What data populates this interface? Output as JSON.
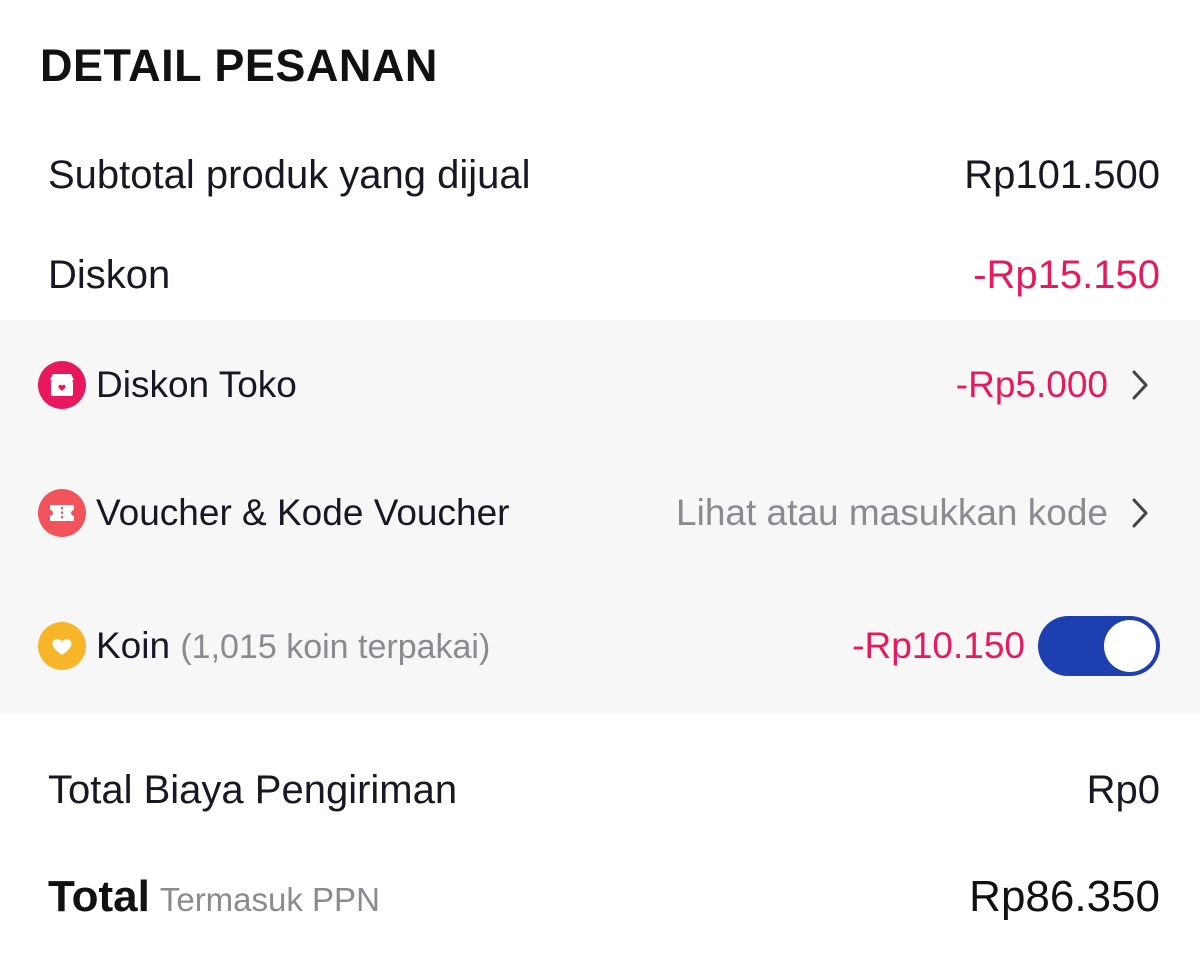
{
  "header": {
    "title": "DETAIL PESANAN"
  },
  "summary": {
    "subtotal_label": "Subtotal produk yang dijual",
    "subtotal_value": "Rp101.500",
    "discount_label": "Diskon",
    "discount_value": "-Rp15.150"
  },
  "discounts": {
    "store": {
      "label": "Diskon Toko",
      "value": "-Rp5.000",
      "icon": "store-icon"
    },
    "voucher": {
      "label": "Voucher & Kode Voucher",
      "value": "Lihat atau masukkan kode",
      "icon": "voucher-icon"
    },
    "coins": {
      "label": "Koin",
      "note": "(1,015 koin terpakai)",
      "value": "-Rp10.150",
      "icon": "coin-icon",
      "toggle_on": true
    }
  },
  "shipping": {
    "label": "Total Biaya Pengiriman",
    "value": "Rp0"
  },
  "total": {
    "label": "Total",
    "note": "Termasuk PPN",
    "value": "Rp86.350"
  },
  "colors": {
    "accent_pink": "#e8185f",
    "toggle_blue": "#1e3fb0",
    "coin_yellow": "#f7b52a",
    "voucher_red": "#f2545b"
  }
}
